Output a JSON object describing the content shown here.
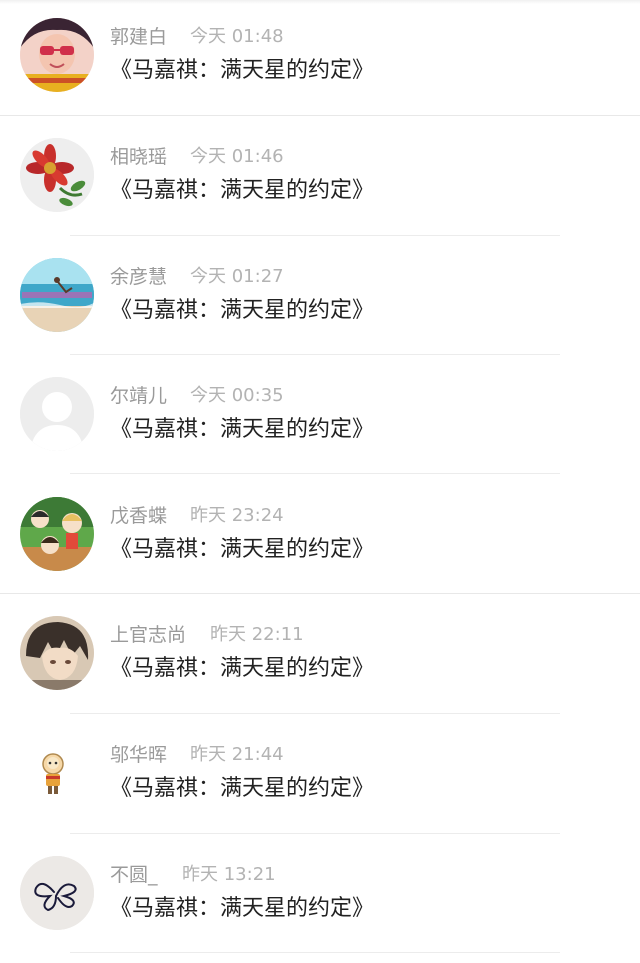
{
  "comments": [
    {
      "name": "郭建白",
      "time": "今天 01:48",
      "title": "《马嘉祺：满天星的约定》",
      "avatar": "sunglasses-girl-avatar"
    },
    {
      "name": "相晓瑶",
      "time": "今天 01:46",
      "title": "《马嘉祺：满天星的约定》",
      "avatar": "red-flower-avatar"
    },
    {
      "name": "余彦慧",
      "time": "今天 01:27",
      "title": "《马嘉祺：满天星的约定》",
      "avatar": "beach-avatar"
    },
    {
      "name": "尔靖儿",
      "time": "今天 00:35",
      "title": "《马嘉祺：满天星的约定》",
      "avatar": "default-avatar"
    },
    {
      "name": "戊香蝶",
      "time": "昨天 23:24",
      "title": "《马嘉祺：满天星的约定》",
      "avatar": "anime-kids-avatar"
    },
    {
      "name": "上官志尚",
      "time": "昨天 22:11",
      "title": "《马嘉祺：满天星的约定》",
      "avatar": "anime-boy-avatar"
    },
    {
      "name": "邬华晖",
      "time": "昨天 21:44",
      "title": "《马嘉祺：满天星的约定》",
      "avatar": "cartoon-monk-avatar"
    },
    {
      "name": "不圆_",
      "time": "昨天 13:21",
      "title": "《马嘉祺：满天星的约定》",
      "avatar": "butterfly-doodle-avatar"
    }
  ]
}
